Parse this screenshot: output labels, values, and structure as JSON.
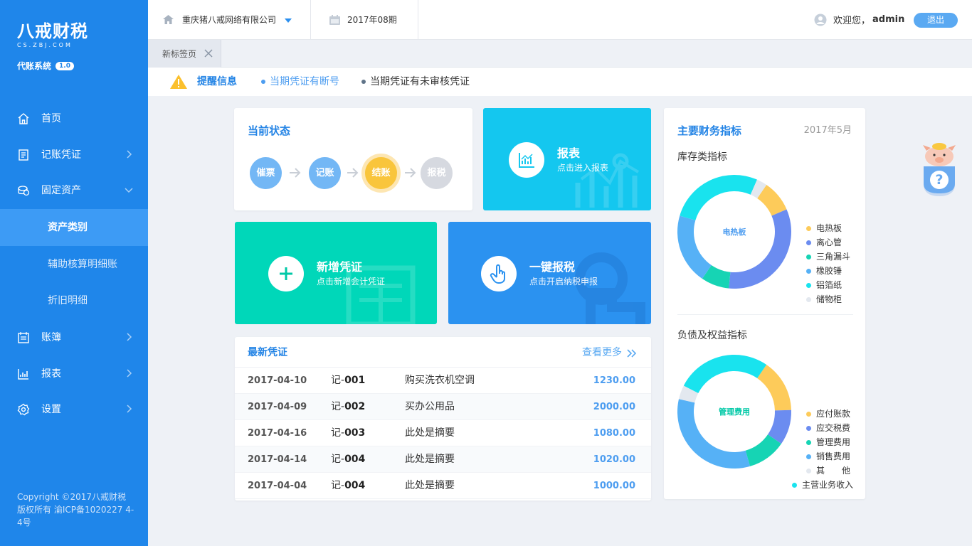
{
  "app": {
    "logo_main": "八戒财税",
    "logo_sub": "CS.ZBJ.COM",
    "system_name": "代账系统",
    "version": "1.0"
  },
  "sidebar": {
    "items": [
      {
        "label": "首页",
        "icon": "home-icon"
      },
      {
        "label": "记账凭证",
        "icon": "voucher-icon"
      },
      {
        "label": "固定资产",
        "icon": "assets-icon"
      },
      {
        "label": "账簿",
        "icon": "ledger-icon"
      },
      {
        "label": "报表",
        "icon": "report-icon"
      },
      {
        "label": "设置",
        "icon": "gear-icon"
      }
    ],
    "sub_items": [
      {
        "label": "资产类别"
      },
      {
        "label": "辅助核算明细账"
      },
      {
        "label": "折旧明细"
      }
    ],
    "copyright": "Copyright ©2017八戒财税 版权所有 渝ICP备1020227 4-4号"
  },
  "topbar": {
    "company": "重庆猪八戒网络有限公司",
    "period": "2017年08期",
    "welcome": "欢迎您，",
    "username": "admin",
    "logout": "退出"
  },
  "tabs": [
    {
      "label": "新标签页"
    }
  ],
  "notice": {
    "title": "提醒信息",
    "items": [
      "当期凭证有断号",
      "当期凭证有未审核凭证"
    ]
  },
  "status": {
    "title": "当前状态",
    "steps": [
      "催票",
      "记账",
      "结账",
      "报税"
    ]
  },
  "tiles": {
    "report": {
      "title": "报表",
      "subtitle": "点击进入报表"
    },
    "voucher": {
      "title": "新增凭证",
      "subtitle": "点击新增会计凭证"
    },
    "tax": {
      "title": "一键报税",
      "subtitle": "点击开启纳税申报"
    }
  },
  "latest": {
    "title": "最新凭证",
    "more": "查看更多",
    "rows": [
      {
        "date": "2017-04-10",
        "prefix": "记-",
        "no": "001",
        "summary": "购买洗衣机空调",
        "amount": "1230.00"
      },
      {
        "date": "2017-04-09",
        "prefix": "记-",
        "no": "002",
        "summary": "买办公用品",
        "amount": "2000.00"
      },
      {
        "date": "2017-04-16",
        "prefix": "记-",
        "no": "003",
        "summary": "此处是摘要",
        "amount": "1080.00"
      },
      {
        "date": "2017-04-14",
        "prefix": "记-",
        "no": "004",
        "summary": "此处是摘要",
        "amount": "1020.00"
      },
      {
        "date": "2017-04-04",
        "prefix": "记-",
        "no": "004",
        "summary": "此处是摘要",
        "amount": "1000.00"
      }
    ]
  },
  "finance": {
    "title": "主要财务指标",
    "date": "2017年5月",
    "inventory": {
      "title": "库存类指标",
      "center": "电热板",
      "center_color": "#4d9df0"
    },
    "liability": {
      "title": "负债及权益指标",
      "center": "管理费用",
      "center_color": "#00c9a7"
    }
  },
  "chart_data": [
    {
      "type": "pie",
      "title": "库存类指标",
      "categories": [
        "电热板",
        "离心管",
        "三角漏斗",
        "橡胶锤",
        "铝箔纸",
        "储物柜"
      ],
      "values": [
        9,
        33,
        8,
        20,
        27,
        3
      ],
      "colors": [
        "#fdcb5a",
        "#6b8cf0",
        "#16d4b4",
        "#56b1f6",
        "#19e3ee",
        "#e3e8ef"
      ]
    },
    {
      "type": "pie",
      "title": "负债及权益指标",
      "categories": [
        "应付账款",
        "应交税费",
        "管理费用",
        "销售费用",
        "其　　他",
        "主营业务收入"
      ],
      "values": [
        15,
        10,
        11,
        33,
        4,
        27
      ],
      "colors": [
        "#fdcb5a",
        "#6b8cf0",
        "#16d4b4",
        "#56b1f6",
        "#e3e8ef",
        "#19e3ee"
      ]
    }
  ],
  "help": {
    "label": "?"
  }
}
